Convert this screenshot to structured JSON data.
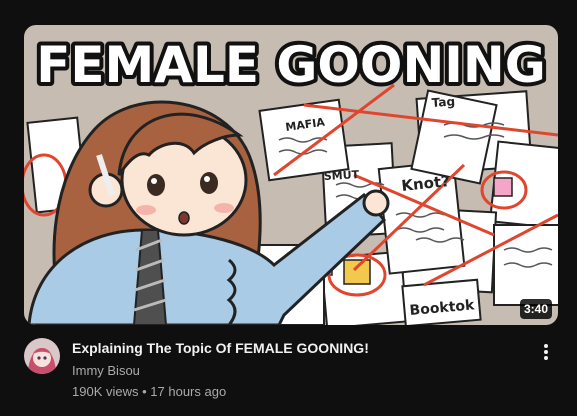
{
  "video": {
    "title": "Explaining The Topic Of FEMALE GOONING!",
    "channel": "Immy Bisou",
    "views": "190K views",
    "separator": "•",
    "age": "17 hours ago",
    "duration": "3:40"
  },
  "thumbnail": {
    "headline": "FEMALE GOONING",
    "notes": [
      "MAFIA",
      "SMUT",
      "Knot?",
      "Booktok",
      "Tag"
    ]
  },
  "icons": {
    "menu": "more-vert-icon",
    "avatar": "channel-avatar"
  },
  "colors": {
    "background": "#0f0f0f",
    "title": "#f1f1f1",
    "secondary": "#aaaaaa",
    "string": "#e0452e"
  }
}
